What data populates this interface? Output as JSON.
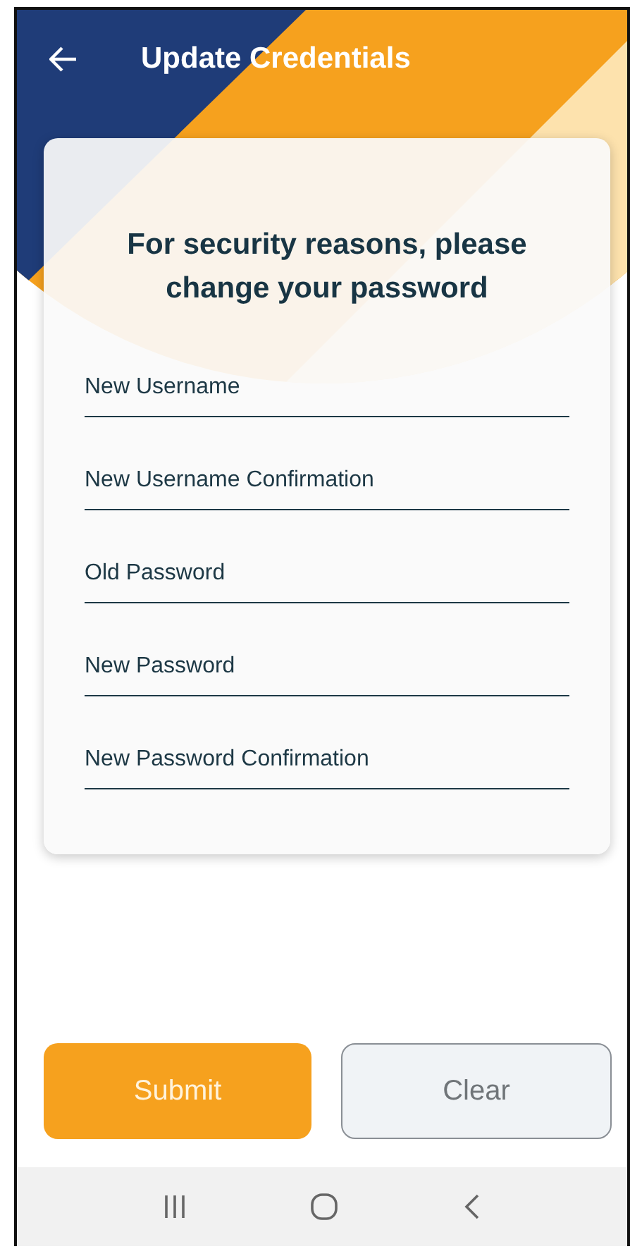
{
  "app_bar": {
    "title": "Update Credentials"
  },
  "heading": "For security reasons, please change your password",
  "fields": [
    {
      "placeholder": "New Username"
    },
    {
      "placeholder": "New Username Confirmation"
    },
    {
      "placeholder": "Old Password"
    },
    {
      "placeholder": "New Password"
    },
    {
      "placeholder": "New Password Confirmation"
    }
  ],
  "buttons": [
    {
      "label": "Submit",
      "kind": "primary"
    },
    {
      "label": "Clear",
      "kind": "secondary"
    }
  ]
}
